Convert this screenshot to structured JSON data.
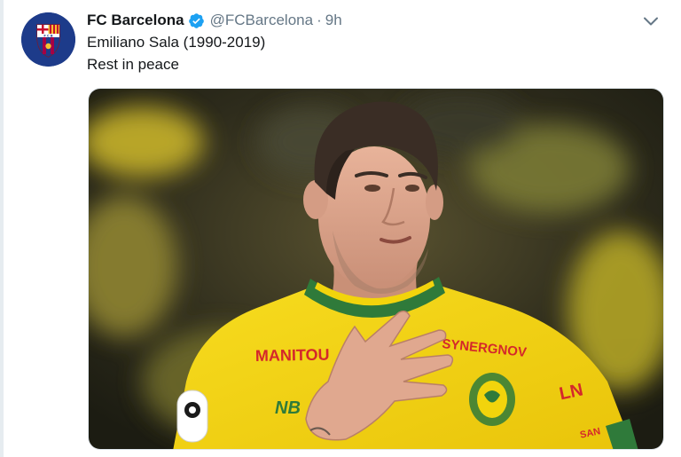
{
  "account": {
    "name": "FC Barcelona",
    "handle": "@FCBarcelona",
    "separator": "·",
    "time": "9h",
    "avatar_icon": "fc-barcelona-crest",
    "verified_icon": "verified-badge-icon"
  },
  "tweet": {
    "line1": "Emiliano Sala (1990-2019)",
    "line2": "Rest in peace"
  },
  "media": {
    "jersey_sponsor": "MANITOU",
    "jersey_text_right": "SYNERGNOV",
    "jersey_brand": "NB"
  },
  "colors": {
    "verified": "#1da1f2",
    "jersey_yellow": "#f2d40c",
    "jersey_green": "#2f7a3a",
    "sponsor_red": "#d4282b"
  }
}
